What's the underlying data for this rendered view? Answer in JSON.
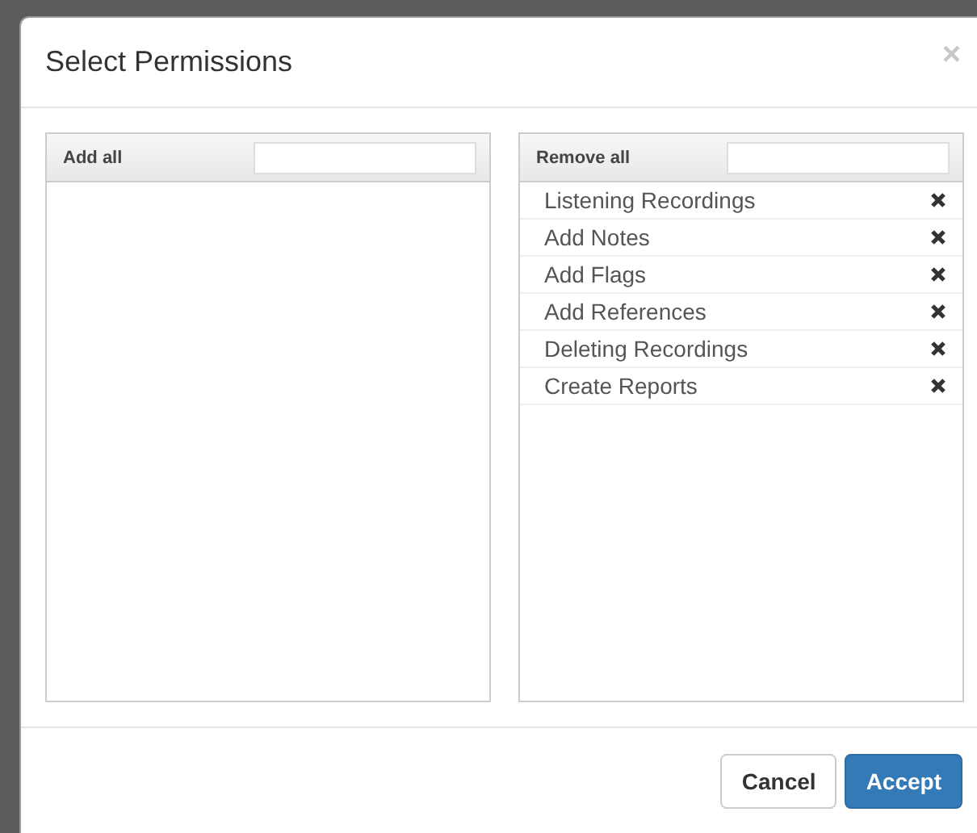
{
  "dialog": {
    "title": "Select Permissions",
    "close": "×"
  },
  "available": {
    "header": "Add all"
  },
  "selected": {
    "header": "Remove all",
    "items": [
      {
        "label": "Listening Recordings"
      },
      {
        "label": "Add Notes"
      },
      {
        "label": "Add Flags"
      },
      {
        "label": "Add References"
      },
      {
        "label": "Deleting Recordings"
      },
      {
        "label": "Create Reports"
      }
    ]
  },
  "buttons": [
    {
      "label": "Cancel",
      "kind": "default"
    },
    {
      "label": "Accept",
      "kind": "primary"
    }
  ]
}
